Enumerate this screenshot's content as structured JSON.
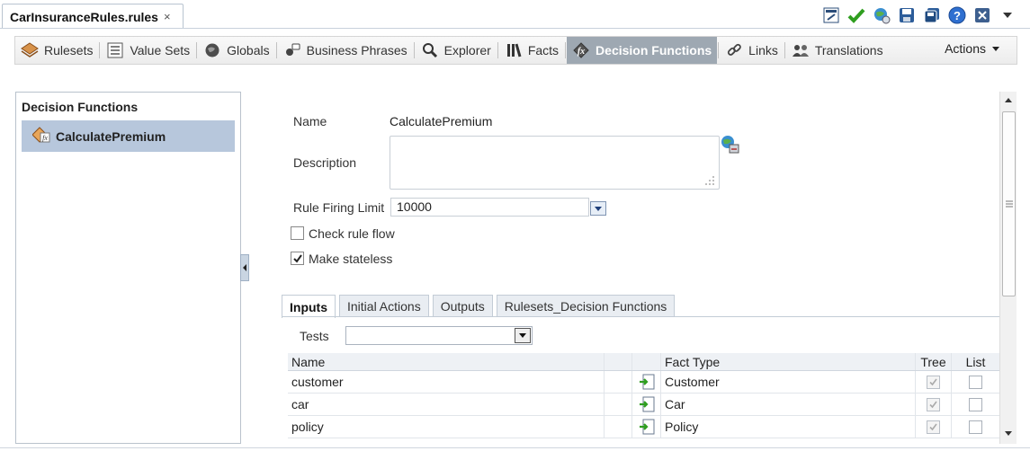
{
  "editor_tab": {
    "title": "CarInsuranceRules.rules",
    "close": "×"
  },
  "toolbar_icons": [
    "edit-icon",
    "validate-check-icon",
    "globe-icon",
    "save-icon",
    "save-all-icon",
    "help-icon",
    "close-box-icon",
    "dropdown-arrow-icon"
  ],
  "nav": {
    "items": [
      {
        "label": "Rulesets",
        "icon": "rulesets-icon"
      },
      {
        "label": "Value Sets",
        "icon": "value-sets-icon"
      },
      {
        "label": "Globals",
        "icon": "globals-icon"
      },
      {
        "label": "Business Phrases",
        "icon": "business-phrases-icon"
      },
      {
        "label": "Explorer",
        "icon": "search-icon"
      },
      {
        "label": "Facts",
        "icon": "facts-icon"
      },
      {
        "label": "Decision Functions",
        "icon": "decision-functions-icon",
        "active": true
      },
      {
        "label": "Links",
        "icon": "link-icon"
      },
      {
        "label": "Translations",
        "icon": "translations-icon"
      }
    ],
    "actions_label": "Actions"
  },
  "left_panel": {
    "title": "Decision Functions",
    "items": [
      {
        "label": "CalculatePremium",
        "selected": true
      }
    ]
  },
  "form": {
    "name_label": "Name",
    "name_value": "CalculatePremium",
    "description_label": "Description",
    "description_value": "",
    "limit_label": "Rule Firing Limit",
    "limit_value": "10000",
    "check_rule_flow_label": "Check rule flow",
    "check_rule_flow_checked": false,
    "make_stateless_label": "Make stateless",
    "make_stateless_checked": true
  },
  "tabs": [
    {
      "label": "Inputs",
      "active": true
    },
    {
      "label": "Initial Actions"
    },
    {
      "label": "Outputs"
    },
    {
      "label": "Rulesets_Decision Functions"
    }
  ],
  "inputs": {
    "tests_label": "Tests",
    "tests_value": "",
    "columns": {
      "name": "Name",
      "fact_type": "Fact Type",
      "tree": "Tree",
      "list": "List"
    },
    "rows": [
      {
        "name": "customer",
        "fact_type": "Customer",
        "tree": true,
        "list": false
      },
      {
        "name": "car",
        "fact_type": "Car",
        "tree": true,
        "list": false
      },
      {
        "name": "policy",
        "fact_type": "Policy",
        "tree": true,
        "list": false
      }
    ]
  },
  "colors": {
    "active_nav_bg": "#9ea8b2",
    "selected_item_bg": "#b7c7dc",
    "check_green": "#2f9e1f"
  }
}
